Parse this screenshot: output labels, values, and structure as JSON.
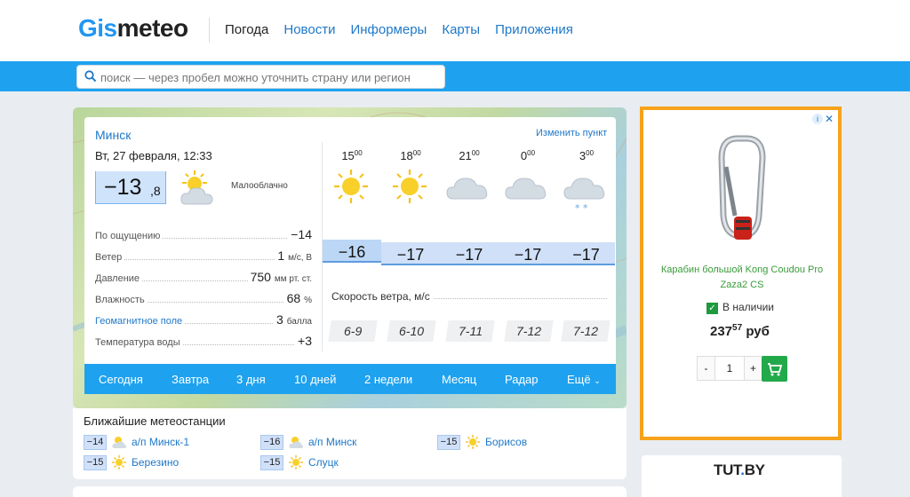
{
  "header": {
    "logo_part1": "Gis",
    "logo_part2": "meteo",
    "nav": [
      "Погода",
      "Новости",
      "Информеры",
      "Карты",
      "Приложения"
    ]
  },
  "search": {
    "placeholder": "поиск — через пробел можно уточнить страну или регион"
  },
  "weather": {
    "city": "Минск",
    "change_location": "Изменить пункт",
    "datetime": "Вт, 27 февраля, 12:33",
    "temp_int": "−13",
    "temp_frac": ",8",
    "condition": "Малооблачно",
    "params": [
      {
        "label": "По ощущению",
        "value": "−14",
        "unit": ""
      },
      {
        "label": "Ветер",
        "value": "1",
        "unit": "м/с, В"
      },
      {
        "label": "Давление",
        "value": "750",
        "unit": "мм рт. ст."
      },
      {
        "label": "Влажность",
        "value": "68",
        "unit": "%"
      },
      {
        "label": "Геомагнитное поле",
        "value": "3",
        "unit": "балла"
      },
      {
        "label": "Температура воды",
        "value": "+3",
        "unit": ""
      }
    ],
    "forecast": [
      {
        "hour": "15",
        "min": "00",
        "temp": "−16",
        "wind": "6-9",
        "icon": "sun-icon"
      },
      {
        "hour": "18",
        "min": "00",
        "temp": "−17",
        "wind": "6-10",
        "icon": "sun-icon"
      },
      {
        "hour": "21",
        "min": "00",
        "temp": "−17",
        "wind": "7-11",
        "icon": "cloud-icon"
      },
      {
        "hour": "0",
        "min": "00",
        "temp": "−17",
        "wind": "7-12",
        "icon": "cloud-icon"
      },
      {
        "hour": "3",
        "min": "00",
        "temp": "−17",
        "wind": "7-12",
        "icon": "cloud-snow-icon"
      }
    ],
    "wind_title": "Скорость ветра, м/с",
    "tabs": [
      "Сегодня",
      "Завтра",
      "3 дня",
      "10 дней",
      "2 недели",
      "Месяц",
      "Радар",
      "Ещё"
    ]
  },
  "stations": {
    "title": "Ближайшие метеостанции",
    "items": [
      {
        "temp": "−14",
        "name": "а/п Минск-1",
        "icon": "partly-cloudy-icon"
      },
      {
        "temp": "−16",
        "name": "а/п Минск",
        "icon": "partly-cloudy-icon"
      },
      {
        "temp": "−15",
        "name": "Борисов",
        "icon": "sun-icon"
      },
      {
        "temp": "−15",
        "name": "Березино",
        "icon": "sun-icon"
      },
      {
        "temp": "−15",
        "name": "Слуцк",
        "icon": "sun-icon"
      }
    ]
  },
  "ad": {
    "title": "Карабин большой Kong Coudou Pro Zaza2 CS",
    "in_stock": "В наличии",
    "price_int": "237",
    "price_frac": "57",
    "currency": "руб",
    "qty": "1",
    "minus": "-",
    "plus": "+"
  },
  "tutby": {
    "logo": "TUT",
    "dot": ".",
    "tld": "BY"
  },
  "colors": {
    "brand_blue": "#1ea2f0",
    "link": "#1f78c8",
    "ad_border": "#f7a21b",
    "cart": "#22a94a"
  }
}
